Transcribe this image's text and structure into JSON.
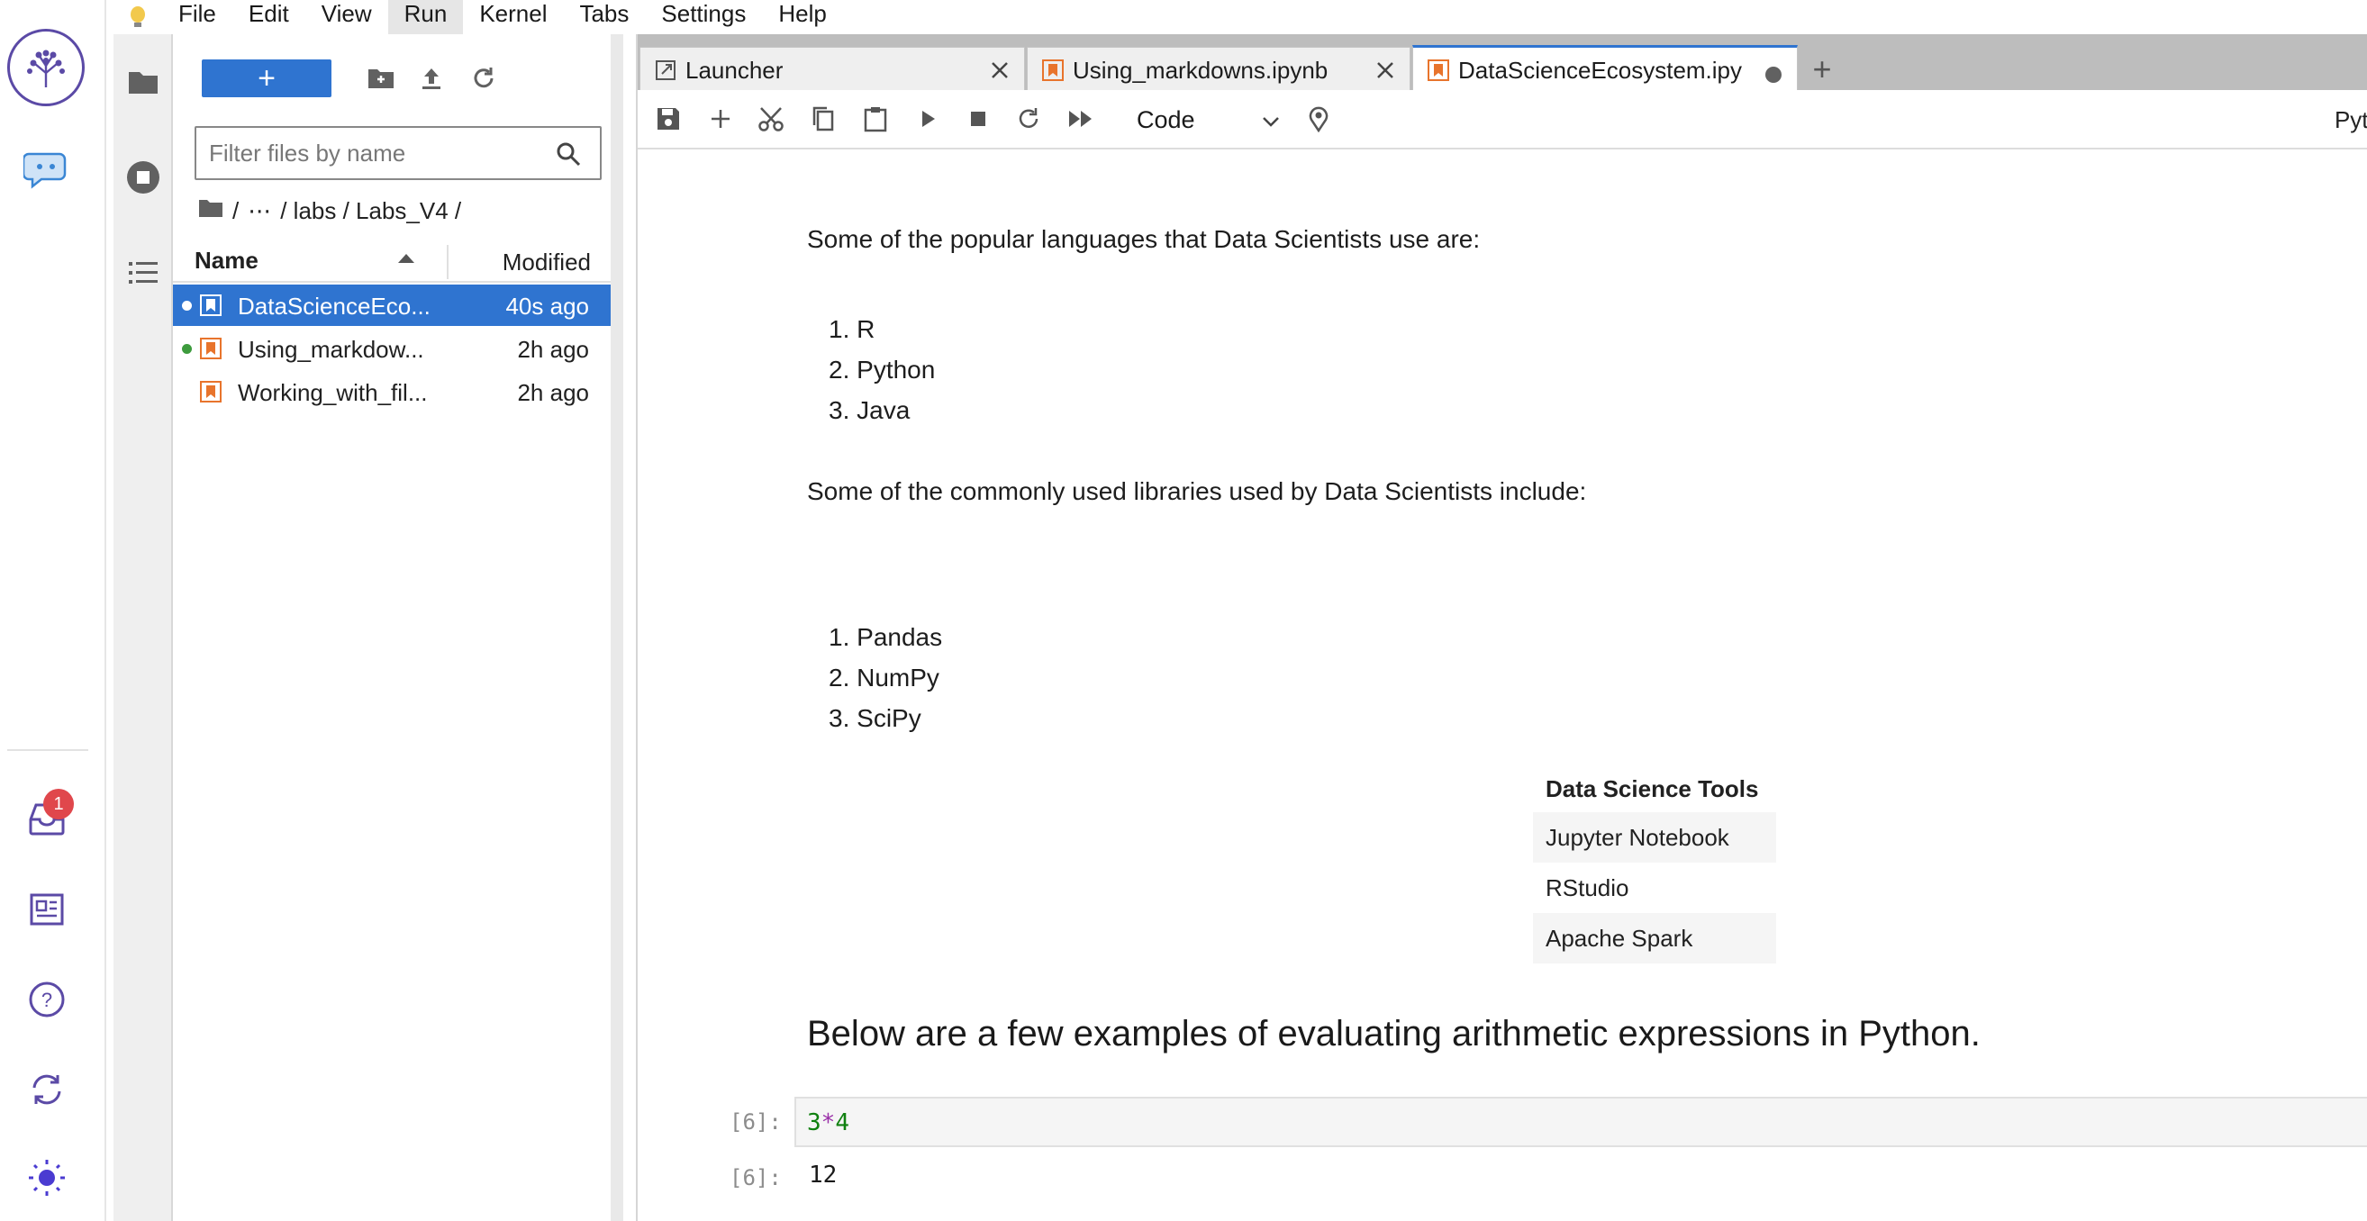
{
  "menubar": {
    "items": [
      "File",
      "Edit",
      "View",
      "Run",
      "Kernel",
      "Tabs",
      "Settings",
      "Help"
    ],
    "active": "Run"
  },
  "outer_rail": {
    "inbox_badge": "1"
  },
  "filebrowser": {
    "filter_placeholder": "Filter files by name",
    "breadcrumb": [
      "/",
      "⋯",
      "/ labs / Labs_V4 /"
    ],
    "header": {
      "name": "Name",
      "modified": "Modified"
    },
    "files": [
      {
        "name": "DataScienceEco...",
        "modified": "40s ago",
        "selected": true,
        "running": true
      },
      {
        "name": "Using_markdow...",
        "modified": "2h ago",
        "selected": false,
        "running": true
      },
      {
        "name": "Working_with_fil...",
        "modified": "2h ago",
        "selected": false,
        "running": false
      }
    ]
  },
  "tabs": [
    {
      "label": "Launcher",
      "icon": "launcher-icon"
    },
    {
      "label": "Using_markdowns.ipynb",
      "icon": "notebook-icon"
    },
    {
      "label": "DataScienceEcosystem.ipy",
      "icon": "notebook-icon",
      "active": true,
      "unsaved": true
    }
  ],
  "toolbar": {
    "cell_type": "Code",
    "kernel": "Pyth"
  },
  "notebook": {
    "languages_intro": "Some of the popular languages that Data Scientists use are:",
    "languages": [
      "R",
      "Python",
      "Java"
    ],
    "libraries_intro": "Some of the commonly used libraries used by Data Scientists include:",
    "libraries": [
      "Pandas",
      "NumPy",
      "SciPy"
    ],
    "table": {
      "header": "Data Science Tools",
      "rows": [
        "Jupyter Notebook",
        "RStudio",
        "Apache Spark"
      ]
    },
    "arith_heading": "Below are a few examples of evaluating arithmetic expressions in Python.",
    "code_cell": {
      "in_prompt": "[6]:",
      "code_left": "3",
      "code_op": "*",
      "code_right": "4",
      "out_prompt": "[6]:",
      "output": "12"
    }
  },
  "colors": {
    "accent": "#2f74d0",
    "brand": "#5b4aa6",
    "notebook_icon": "#e8742c",
    "running_dot": "#3d9b3d"
  }
}
